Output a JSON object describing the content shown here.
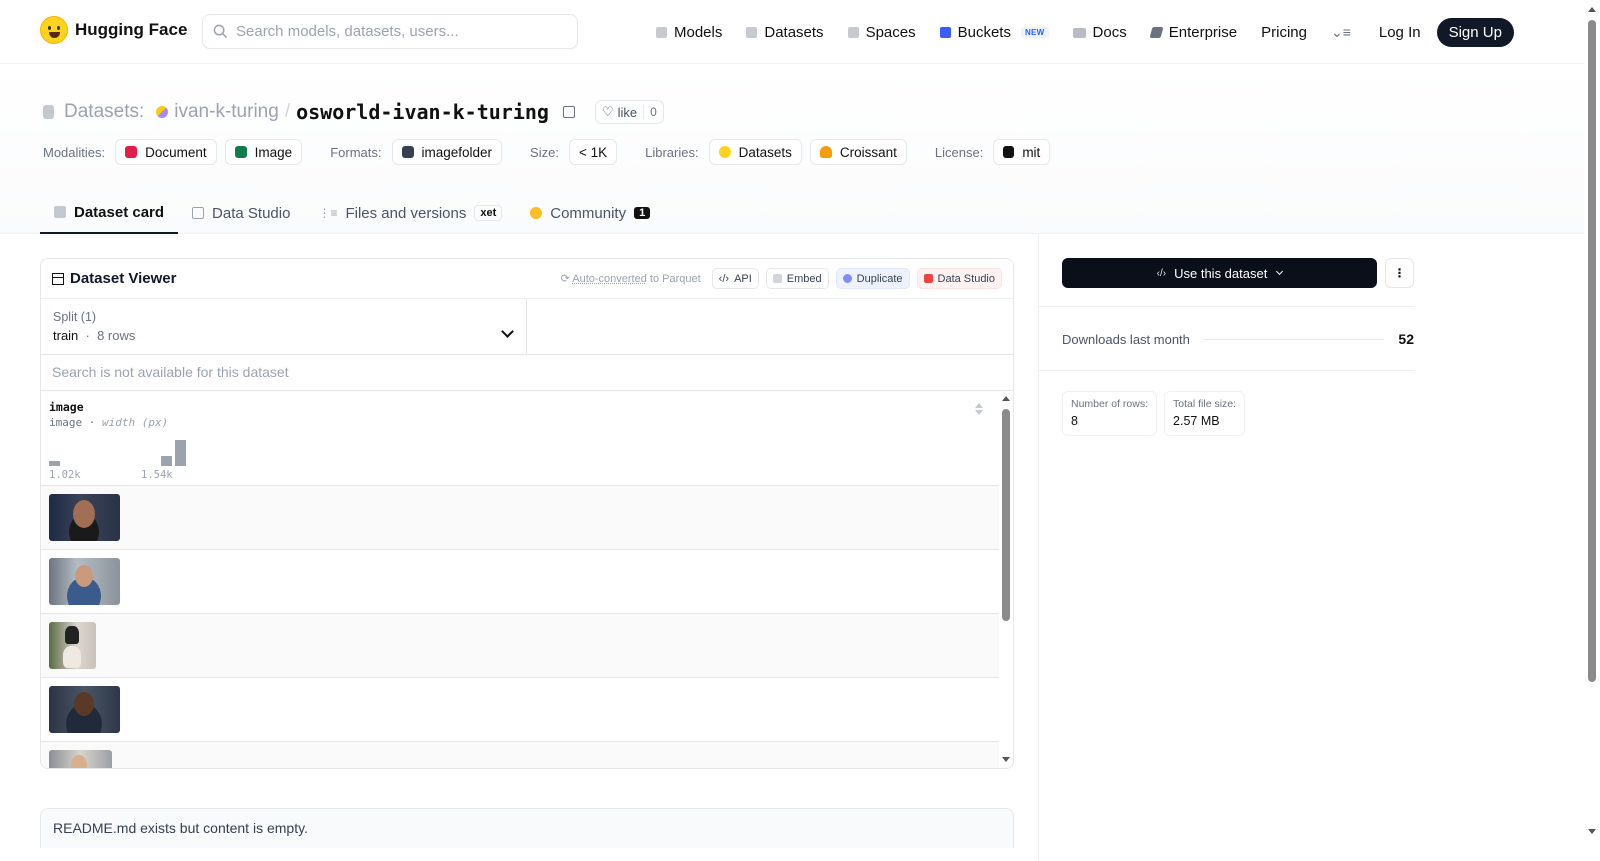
{
  "nav": {
    "brand": "Hugging Face",
    "search_placeholder": "Search models, datasets, users...",
    "links": [
      {
        "label": "Models",
        "icon": "cube-icon"
      },
      {
        "label": "Datasets",
        "icon": "database-icon"
      },
      {
        "label": "Spaces",
        "icon": "grid-icon"
      },
      {
        "label": "Buckets",
        "icon": "bucket-icon",
        "badge": "NEW"
      },
      {
        "label": "Docs",
        "icon": "book-icon"
      },
      {
        "label": "Enterprise",
        "icon": "enterprise-icon"
      },
      {
        "label": "Pricing"
      }
    ],
    "login": "Log In",
    "signup": "Sign Up"
  },
  "repo": {
    "type_label": "Datasets:",
    "owner": "ivan-k-turing",
    "separator": "/",
    "name": "osworld-ivan-k-turing",
    "like_label": "like",
    "like_count": "0"
  },
  "tags": {
    "modalities_label": "Modalities:",
    "modalities": [
      "Document",
      "Image"
    ],
    "formats_label": "Formats:",
    "formats": [
      "imagefolder"
    ],
    "size_label": "Size:",
    "size": "< 1K",
    "libraries_label": "Libraries:",
    "libraries": [
      "Datasets",
      "Croissant"
    ],
    "license_label": "License:",
    "license": "mit"
  },
  "tabs": [
    {
      "label": "Dataset card",
      "active": true
    },
    {
      "label": "Data Studio"
    },
    {
      "label": "Files and versions",
      "badge": "xet"
    },
    {
      "label": "Community",
      "count": "1"
    }
  ],
  "viewer": {
    "title": "Dataset Viewer",
    "autoconv_prefix": "Auto-converted",
    "autoconv_suffix": " to Parquet",
    "actions": [
      "API",
      "Embed",
      "Duplicate",
      "Data Studio"
    ],
    "split_label": "Split (1)",
    "split_name": "train",
    "split_rows": "8 rows",
    "search_na": "Search is not available for this dataset",
    "column": {
      "name": "image",
      "type": "image",
      "meta": "width (px)",
      "hist_min": "1.02k",
      "hist_max": "1.54k",
      "histogram": [
        1,
        0,
        0,
        0,
        0,
        0,
        0,
        0,
        2,
        5
      ]
    },
    "rows": [
      "row-1",
      "row-2",
      "row-3",
      "row-4",
      "row-5"
    ]
  },
  "readme_text": "README.md exists but content is empty.",
  "sidebar": {
    "use_button": "Use this dataset",
    "downloads_label": "Downloads last month",
    "downloads_value": "52",
    "stats": [
      {
        "label": "Number of rows:",
        "value": "8"
      },
      {
        "label": "Total file size:",
        "value": "2.57 MB"
      }
    ]
  }
}
